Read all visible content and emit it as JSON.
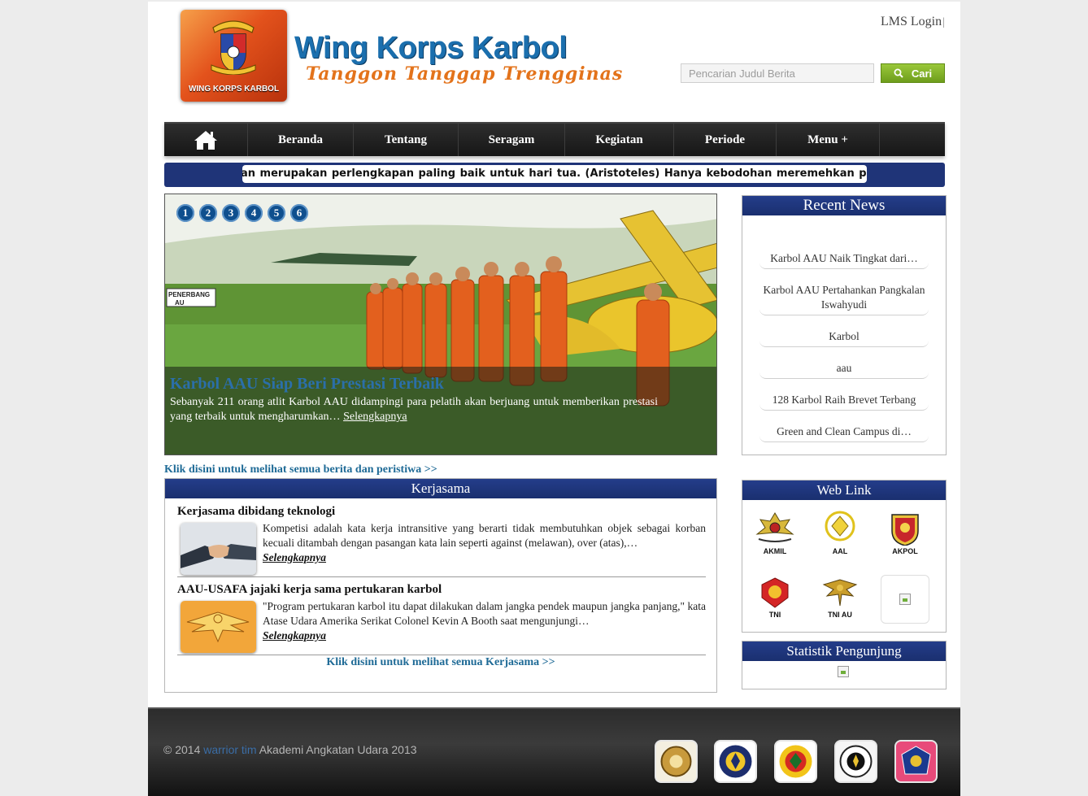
{
  "header": {
    "logo_caption": "WING KORPS KARBOL",
    "title": "Wing Korps Karbol",
    "motto": "Tanggon Tanggap Trengginas",
    "lms_login": "LMS Login",
    "lms_separator": "|",
    "search_placeholder": "Pencarian Judul Berita",
    "search_button": "Cari"
  },
  "nav": {
    "items": [
      {
        "label": "Beranda"
      },
      {
        "label": "Tentang"
      },
      {
        "label": "Seragam"
      },
      {
        "label": "Kegiatan"
      },
      {
        "label": "Periode"
      },
      {
        "label": "Menu +"
      }
    ]
  },
  "ticker": {
    "text": "an merupakan perlengkapan paling baik untuk hari tua. (Aristoteles)          Hanya kebodohan meremehkan p"
  },
  "slider": {
    "pages": [
      "1",
      "2",
      "3",
      "4",
      "5",
      "6"
    ],
    "sign_text": "PENERBANG",
    "sign_text2": "AU",
    "title": "Karbol AAU Siap Beri Prestasi Terbaik",
    "text": "Sebanyak 211 orang atlit Karbol AAU didampingi para pelatih akan berjuang untuk memberikan prestasi yang terbaik untuk mengharumkan…",
    "more": "Selengkapnya"
  },
  "all_news_link": "Klik disini untuk melihat semua berita dan peristiwa >>",
  "kerjasama": {
    "header": "Kerjasama",
    "items": [
      {
        "title": "Kerjasama dibidang teknologi",
        "text": "Kompetisi adalah kata kerja intransitive yang berarti tidak membutuhkan objek sebagai korban kecuali ditambah dengan pasangan kata lain seperti against (melawan), over (atas),…",
        "more": "Selengkapnya"
      },
      {
        "title": "AAU-USAFA jajaki kerja sama pertukaran karbol",
        "text": "\"Program pertukaran karbol itu dapat dilakukan dalam jangka pendek maupun jangka panjang,\" kata Atase Udara Amerika Serikat Colonel Kevin A Booth saat mengunjungi…",
        "more": "Selengkapnya"
      }
    ],
    "all_link": "Klik disini untuk melihat semua Kerjasama >>"
  },
  "recent_news": {
    "header": "Recent News",
    "items": [
      "Karbol AAU Naik Tingkat dari…",
      "Karbol AAU Pertahankan Pangkalan Iswahyudi",
      "Karbol",
      "aau",
      "128 Karbol Raih Brevet Terbang",
      "Green and Clean Campus di…"
    ]
  },
  "web_link": {
    "header": "Web Link",
    "items": [
      {
        "label": "AKMIL",
        "icon": "akmil-emblem-icon"
      },
      {
        "label": "AAL",
        "icon": "aal-emblem-icon"
      },
      {
        "label": "AKPOL",
        "icon": "akpol-emblem-icon"
      },
      {
        "label": "TNI",
        "icon": "tni-emblem-icon"
      },
      {
        "label": "TNI AU",
        "icon": "tni-au-emblem-icon"
      },
      {
        "label": "",
        "icon": "broken-image-icon"
      }
    ]
  },
  "statistik": {
    "header": "Statistik Pengunjung"
  },
  "footer": {
    "copyright": "© 2014 ",
    "link": "warrior tim",
    "org": " Akademi Angkatan Udara 2013",
    "partners": [
      "partner-logo-1",
      "partner-logo-2",
      "partner-logo-3",
      "partner-logo-4",
      "partner-logo-5"
    ]
  },
  "colors": {
    "brand_blue": "#1b6fae",
    "brand_orange": "#e3731b",
    "box_header": "#1f3478",
    "link": "#1e6a96",
    "search_green": "#7aab26"
  }
}
